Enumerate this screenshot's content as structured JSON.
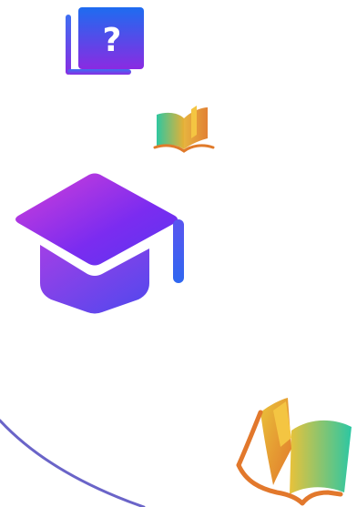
{
  "icons": {
    "help_book": {
      "name": "help-book-icon",
      "glyph": "?",
      "colors": [
        "#1e6cf0",
        "#8a2be2"
      ]
    },
    "small_book": {
      "name": "open-book-icon",
      "colors": [
        "#2fc7a0",
        "#e6b035",
        "#e07a2a"
      ]
    },
    "graduation_cap": {
      "name": "graduation-cap-icon",
      "colors": [
        "#d23fd8",
        "#7b2cf0",
        "#2f67f0"
      ]
    },
    "large_book": {
      "name": "open-book-icon",
      "colors": [
        "#2cc7a3",
        "#e9c23a",
        "#e2782c"
      ]
    }
  },
  "decoration": {
    "arc_color": "#6a64c8"
  }
}
